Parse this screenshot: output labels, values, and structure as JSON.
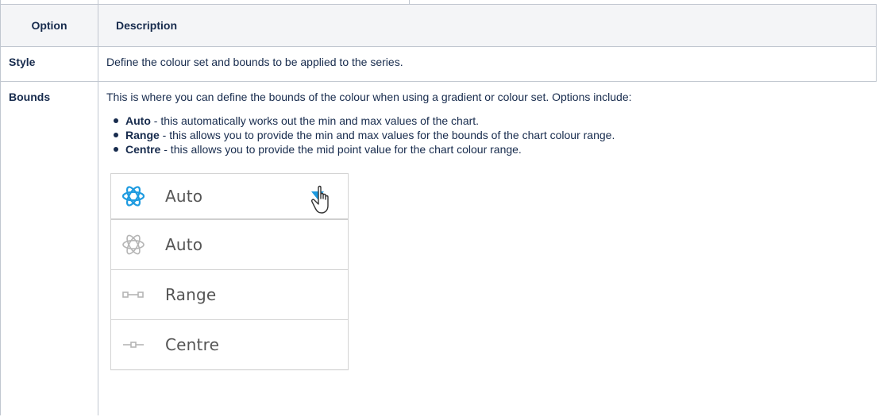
{
  "table": {
    "headers": {
      "option": "Option",
      "description": "Description"
    },
    "rows": [
      {
        "option": "Style",
        "description": "Define the colour set and bounds to be applied to the series."
      },
      {
        "option": "Bounds",
        "intro": "This is where you can define the bounds of the colour when using a gradient or colour set. Options include:",
        "bullets": [
          {
            "term": "Auto",
            "text": " - this automatically works out the min and max values of the chart."
          },
          {
            "term": "Range",
            "text": " - this allows you to provide the min and max values for the bounds of the chart colour range."
          },
          {
            "term": "Centre",
            "text": " - this allows you to provide the mid point value for the chart colour range."
          }
        ]
      }
    ]
  },
  "dropdown": {
    "selected": {
      "label": "Auto",
      "icon": "atom-icon",
      "icon_color": "#1e9be0"
    },
    "options": [
      {
        "label": "Auto",
        "icon": "atom-icon"
      },
      {
        "label": "Range",
        "icon": "range-icon"
      },
      {
        "label": "Centre",
        "icon": "centre-icon"
      }
    ],
    "arrow_color": "#1e9be0",
    "option_icon_color": "#b5b5b5"
  }
}
